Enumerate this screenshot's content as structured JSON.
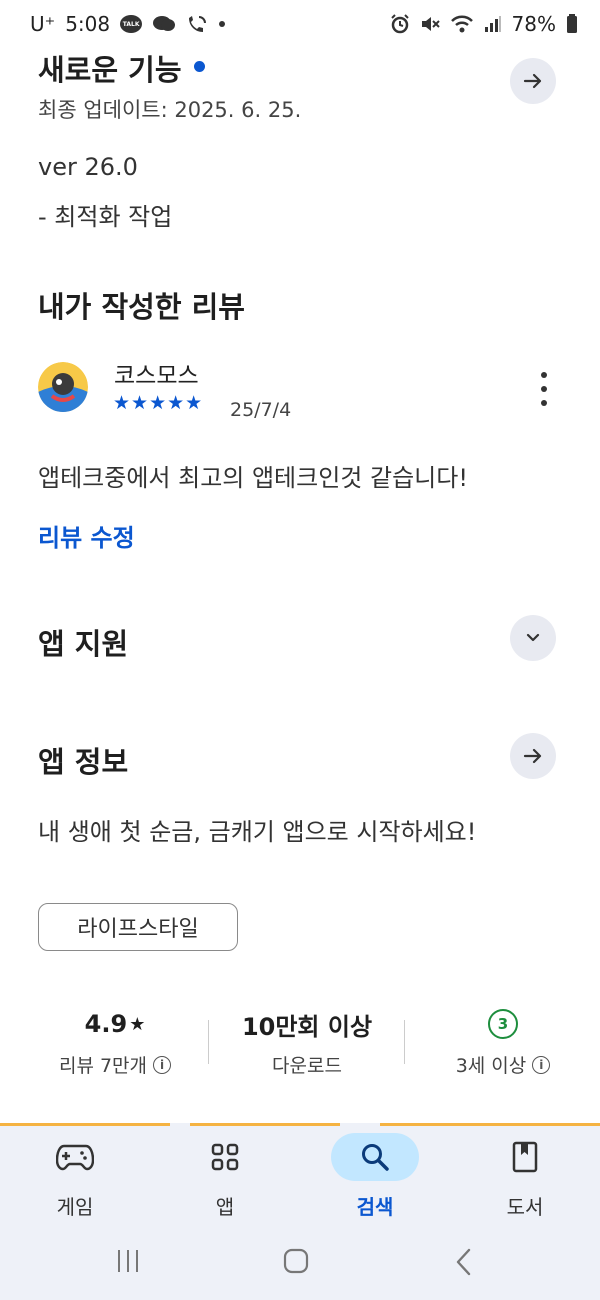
{
  "status_bar": {
    "carrier": "U⁺",
    "time": "5:08",
    "battery": "78%",
    "icons": [
      "kakaotalk-icon",
      "chat-icon",
      "wifi-call-icon",
      "dot-icon",
      "alarm-icon",
      "mute-icon",
      "wifi-icon",
      "signal-icon",
      "battery-icon"
    ]
  },
  "whats_new": {
    "title": "새로운 기능",
    "updated": "최종 업데이트: 2025. 6. 25.",
    "version": "ver 26.0",
    "note": "- 최적화 작업"
  },
  "my_review": {
    "title": "내가 작성한 리뷰",
    "reviewer": "코스모스",
    "stars": "★★★★★",
    "rating": 5,
    "date": "25/7/4",
    "text": "앱테크중에서 최고의 앱테크인것 같습니다!",
    "edit_label": "리뷰 수정"
  },
  "app_support": {
    "title": "앱 지원"
  },
  "app_info": {
    "title": "앱 정보",
    "description": "내 생애 첫 순금, 금캐기 앱으로 시작하세요!",
    "category": "라이프스타일"
  },
  "stats": {
    "rating_value": "4.9",
    "rating_star": "★",
    "rating_label": "리뷰 7만개",
    "downloads_value": "10만회 이상",
    "downloads_label": "다운로드",
    "age_badge": "3",
    "age_label": "3세 이상"
  },
  "bottom_nav": {
    "items": [
      {
        "label": "게임",
        "icon": "gamepad-icon"
      },
      {
        "label": "앱",
        "icon": "apps-grid-icon"
      },
      {
        "label": "검색",
        "icon": "search-icon",
        "active": true
      },
      {
        "label": "도서",
        "icon": "book-icon"
      }
    ]
  },
  "colors": {
    "accent": "#0b57d0",
    "nav_bg": "#eef1f8",
    "active_pill": "#c2e7ff",
    "age_green": "#1e8e3e"
  }
}
